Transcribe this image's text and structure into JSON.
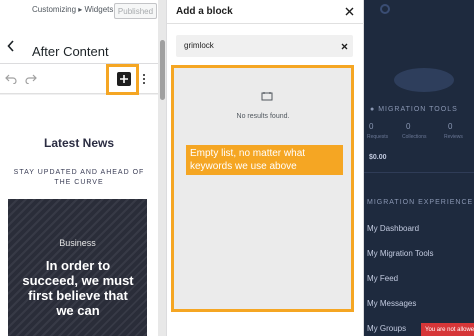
{
  "customizer": {
    "breadcrumb": "Customizing ▸ Widgets",
    "section_title": "After Content",
    "published_label": "Published",
    "canvas": {
      "heading": "Latest News",
      "subheading": "STAY UPDATED AND AHEAD OF THE CURVE",
      "post": {
        "category": "Business",
        "title": "In order to succeed, we must first believe that we can"
      }
    }
  },
  "inserter": {
    "title": "Add a block",
    "search": {
      "value": "grimlock"
    },
    "no_results": "No results found.",
    "annotation": "Empty list, no matter what keywords we use above"
  },
  "preview": {
    "migration_tools": "MIGRATION TOOLS",
    "stats": [
      "0",
      "0",
      "0"
    ],
    "stat_labels": [
      "Requests",
      "Collections",
      "Reviews"
    ],
    "money": "$0.00",
    "experience": "MIGRATION EXPERIENCE",
    "menu": [
      "My Dashboard",
      "My Migration Tools",
      "My Feed",
      "My Messages",
      "My Groups"
    ],
    "badge": "You are not allowed"
  },
  "colors": {
    "highlight": "#f5a623",
    "preview_bg": "#1e2a3e",
    "badge": "#d63638"
  }
}
